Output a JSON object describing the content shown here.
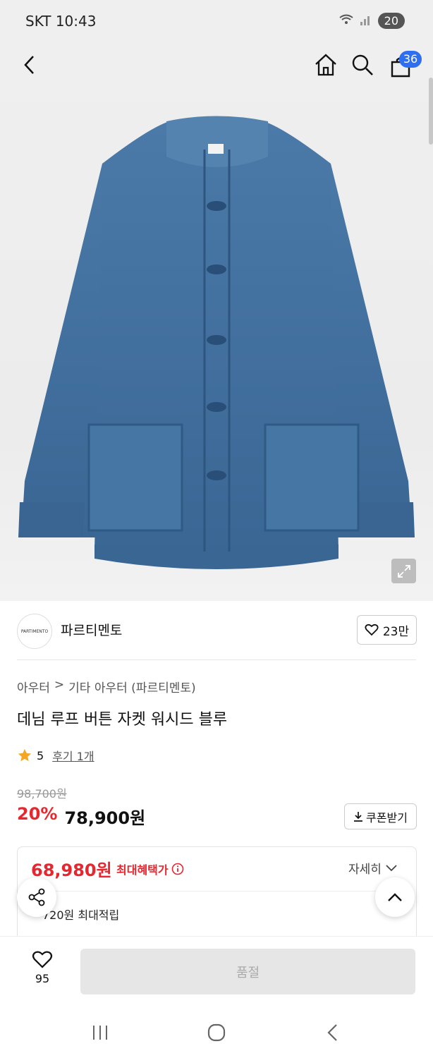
{
  "status": {
    "carrier_time": "SKT 10:43",
    "battery": "20"
  },
  "header": {
    "cart_count": "36"
  },
  "brand": {
    "logo_text": "PARTIMENTO",
    "name": "파르티멘토",
    "likes": "23만"
  },
  "breadcrumb": {
    "category": "아우터",
    "separator": ">",
    "subcategory": "기타 아우터 (파르티멘토)"
  },
  "product": {
    "title": "데님 루프 버튼 자켓 워시드 블루",
    "rating": "5",
    "review_text": "후기 1개",
    "original_price": "98,700원",
    "discount": "20%",
    "price": "78,900원",
    "coupon_label": "쿠폰받기"
  },
  "benefit": {
    "price": "68,980원",
    "label": "최대혜택가",
    "detail_label": "자세히",
    "points": "720원 최대적립"
  },
  "bottom": {
    "wish_count": "95",
    "buy_label": "품절"
  },
  "colors": {
    "accent_red": "#e8262e",
    "badge_blue": "#2d6ff0",
    "denim": "#3f6e9e"
  }
}
